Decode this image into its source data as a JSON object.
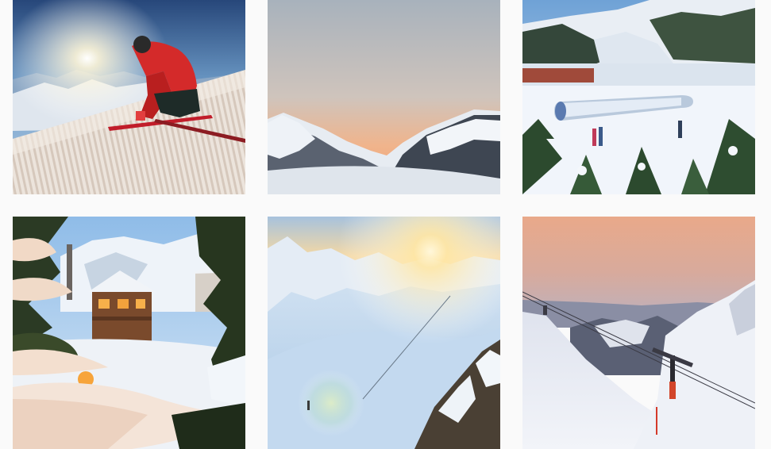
{
  "gallery": {
    "posts": [
      {
        "subject": "skier-carving-at-sunrise"
      },
      {
        "subject": "mountain-peaks-at-dusk"
      },
      {
        "subject": "ski-resort-with-covered-conveyor"
      },
      {
        "subject": "snowy-chalet-through-pine-branches"
      },
      {
        "subject": "sun-over-ski-slopes"
      },
      {
        "subject": "chairlift-at-twilight"
      }
    ]
  },
  "colors": {
    "page_background": "#fafafa",
    "snow": "#f1f5fb",
    "sky_blue": "#7fb0dd",
    "dusk_orange": "#f2b07a",
    "jacket_red": "#d42a2a",
    "pine_green": "#2c4a2e"
  }
}
